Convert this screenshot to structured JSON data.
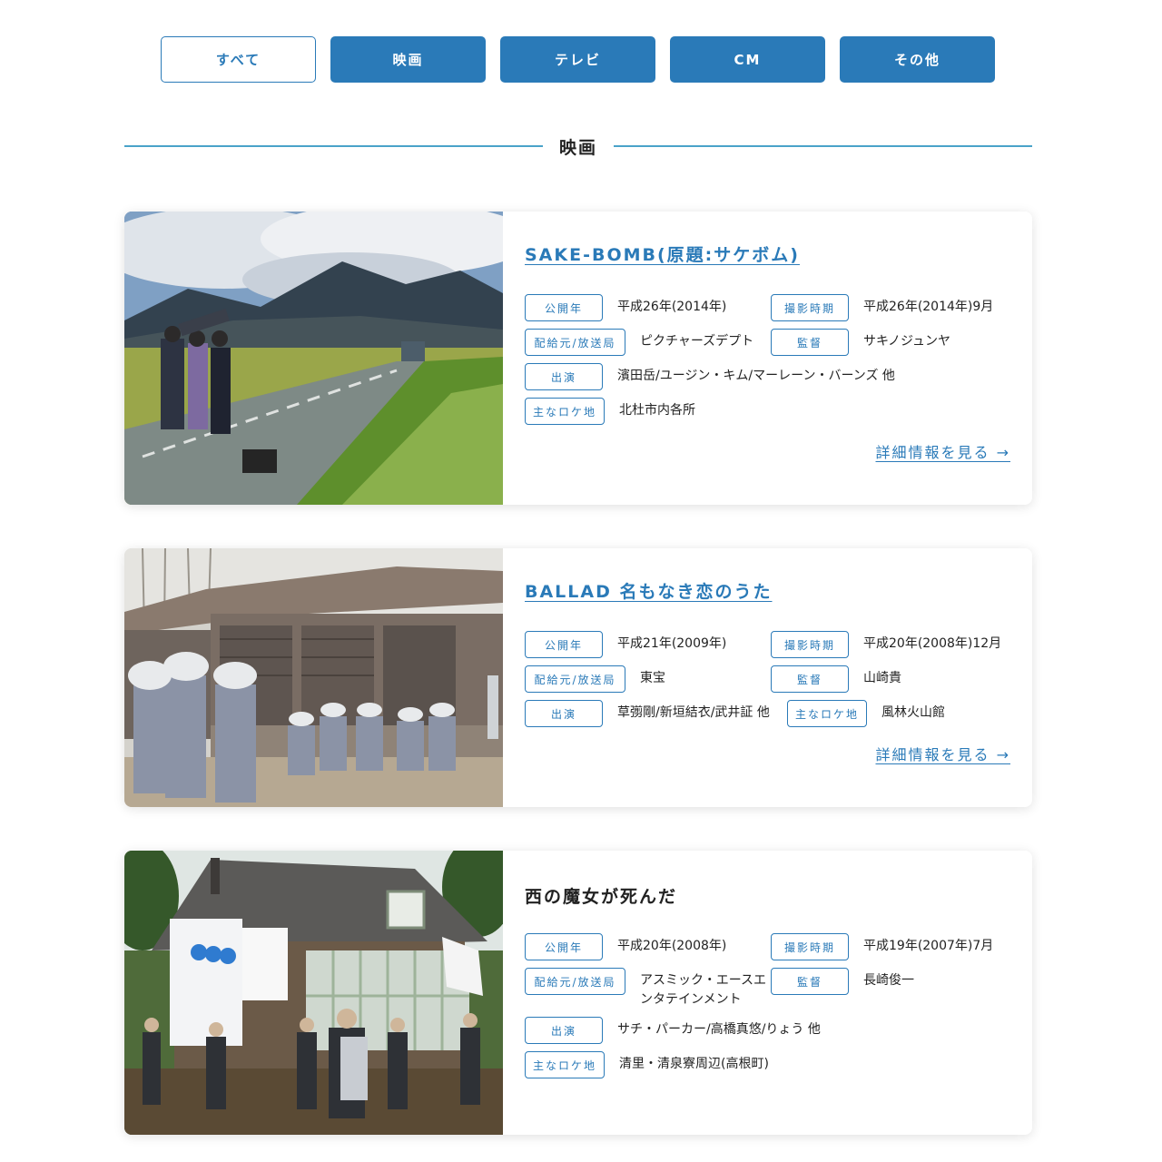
{
  "filters": [
    {
      "label": "すべて"
    },
    {
      "label": "映画"
    },
    {
      "label": "テレビ"
    },
    {
      "label": "CM"
    },
    {
      "label": "その他"
    }
  ],
  "section": {
    "heading": "映画"
  },
  "labels": {
    "release_year": "公開年",
    "shoot_period": "撮影時期",
    "distributor": "配給元/放送局",
    "director": "監督",
    "cast": "出演",
    "location": "主なロケ地"
  },
  "works": [
    {
      "title": "SAKE-BOMB(原題:サケボム)",
      "release_year": "平成26年(2014年)",
      "shoot_period": "平成26年(2014年)9月",
      "distributor": "ピクチャーズデプト",
      "director": "サキノジュンヤ",
      "cast": "濱田岳/ユージン・キム/マーレーン・バーンズ 他",
      "location": "北杜市内各所",
      "more_link": "詳細情報を見る →"
    },
    {
      "title": "BALLAD 名もなき恋のうた",
      "release_year": "平成21年(2009年)",
      "shoot_period": "平成20年(2008年)12月",
      "distributor": "東宝",
      "director": "山崎貴",
      "cast": "草彅剛/新垣結衣/武井証 他",
      "location": "風林火山館",
      "more_link": "詳細情報を見る →"
    },
    {
      "title": "西の魔女が死んだ",
      "release_year": "平成20年(2008年)",
      "shoot_period": "平成19年(2007年)7月",
      "distributor_line1": "アスミック・エースエ",
      "distributor_line2": "ンタテインメント",
      "director": "長崎俊一",
      "cast": "サチ・パーカー/高橋真悠/りょう 他",
      "location": "清里・清泉寮周辺(高根町)"
    }
  ]
}
